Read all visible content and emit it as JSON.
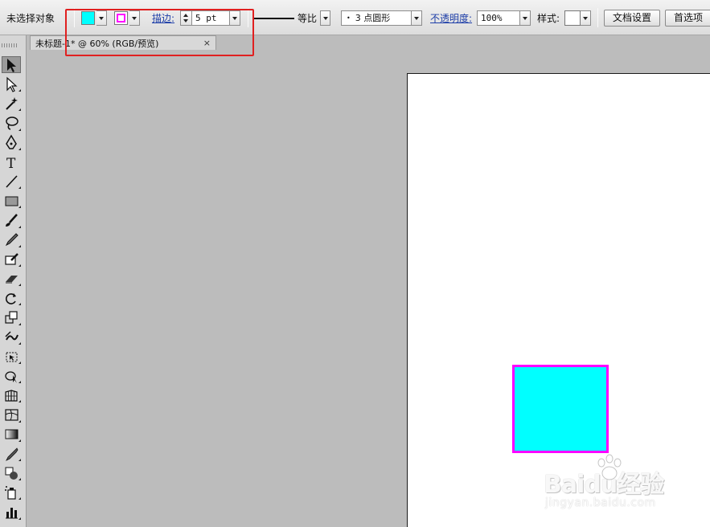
{
  "control_bar": {
    "selection_label": "未选择对象",
    "fill_color": "#00ffff",
    "stroke_color": "#ff00ff",
    "stroke_label": "描边:",
    "stroke_weight": "5 pt",
    "profile_label": "等比",
    "brush_label": "3 点圆形",
    "brush_dot": "•",
    "opacity_label": "不透明度:",
    "opacity_value": "100%",
    "style_label": "样式:",
    "document_setup_label": "文档设置",
    "preferences_label": "首选项"
  },
  "document": {
    "tab_title": "未标题-1* @ 60% (RGB/预览)",
    "close_glyph": "×"
  },
  "tools": [
    {
      "name": "selection-tool",
      "icon": "arrow-icon"
    },
    {
      "name": "direct-selection-tool",
      "icon": "hollow-arrow-icon"
    },
    {
      "name": "magic-wand-tool",
      "icon": "magic-wand-icon"
    },
    {
      "name": "lasso-tool",
      "icon": "lasso-icon"
    },
    {
      "name": "pen-tool",
      "icon": "pen-icon"
    },
    {
      "name": "type-tool",
      "icon": "type-icon",
      "glyph": "T"
    },
    {
      "name": "line-tool",
      "icon": "line-icon"
    },
    {
      "name": "rectangle-tool",
      "icon": "rectangle-icon"
    },
    {
      "name": "paintbrush-tool",
      "icon": "brush-icon"
    },
    {
      "name": "pencil-tool",
      "icon": "pencil-icon"
    },
    {
      "name": "blob-brush-tool",
      "icon": "blob-brush-icon"
    },
    {
      "name": "eraser-tool",
      "icon": "eraser-icon"
    },
    {
      "name": "rotate-tool",
      "icon": "rotate-icon"
    },
    {
      "name": "scale-tool",
      "icon": "scale-icon"
    },
    {
      "name": "warp-tool",
      "icon": "warp-icon"
    },
    {
      "name": "free-transform-tool",
      "icon": "free-transform-icon"
    },
    {
      "name": "shape-builder-tool",
      "icon": "shape-builder-icon"
    },
    {
      "name": "perspective-grid-tool",
      "icon": "perspective-grid-icon"
    },
    {
      "name": "mesh-tool",
      "icon": "mesh-icon"
    },
    {
      "name": "gradient-tool",
      "icon": "gradient-icon"
    },
    {
      "name": "eyedropper-tool",
      "icon": "eyedropper-icon"
    },
    {
      "name": "blend-tool",
      "icon": "blend-icon"
    },
    {
      "name": "symbol-sprayer-tool",
      "icon": "symbol-sprayer-icon"
    },
    {
      "name": "column-graph-tool",
      "icon": "column-graph-icon"
    }
  ],
  "watermark": {
    "brand": "Baidu",
    "brand_cn": "经验",
    "domain": "jingyan.baidu.com"
  }
}
